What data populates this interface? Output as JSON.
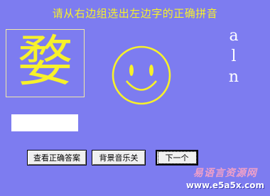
{
  "title": "请从右边组选出左边字的正确拼音",
  "character": "婺",
  "choices": [
    "a",
    "l",
    "n"
  ],
  "answer_field": {
    "value": ""
  },
  "buttons": {
    "show_answer": "查看正确答案",
    "music_toggle": "背景音乐关",
    "next": "下一个"
  },
  "watermark": {
    "top": "易语言资源网",
    "bottom": "www.e5a5x.com"
  },
  "colors": {
    "background": "#7d7cf0",
    "accent": "#f7f12a"
  }
}
